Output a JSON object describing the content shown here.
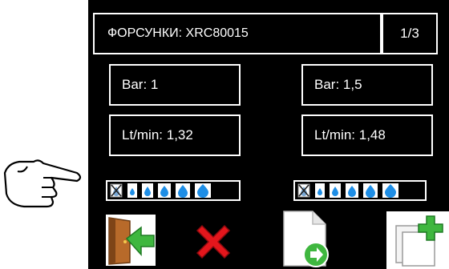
{
  "header": {
    "title": "ФОРСУНКИ: XRC80015",
    "page": "1/3"
  },
  "left": {
    "pressure": "Bar: 1",
    "flow": "Lt/min: 1,32"
  },
  "right": {
    "pressure": "Bar: 1,5",
    "flow": "Lt/min: 1,48"
  },
  "drop_selector": {
    "icons": [
      "none-icon",
      "drop-icon-xs",
      "drop-icon-s",
      "drop-icon-m",
      "drop-icon-l",
      "drop-icon-xl"
    ]
  },
  "toolbar": {
    "icons": [
      "exit-door-icon",
      "cancel-x-icon",
      "next-document-icon",
      "add-copy-icon"
    ]
  },
  "colors": {
    "screen_bg": "#000000",
    "text": "#ffffff",
    "drop": "#1e8ee6",
    "cancel": "#e4161c",
    "arrow_green": "#3fb73f"
  }
}
